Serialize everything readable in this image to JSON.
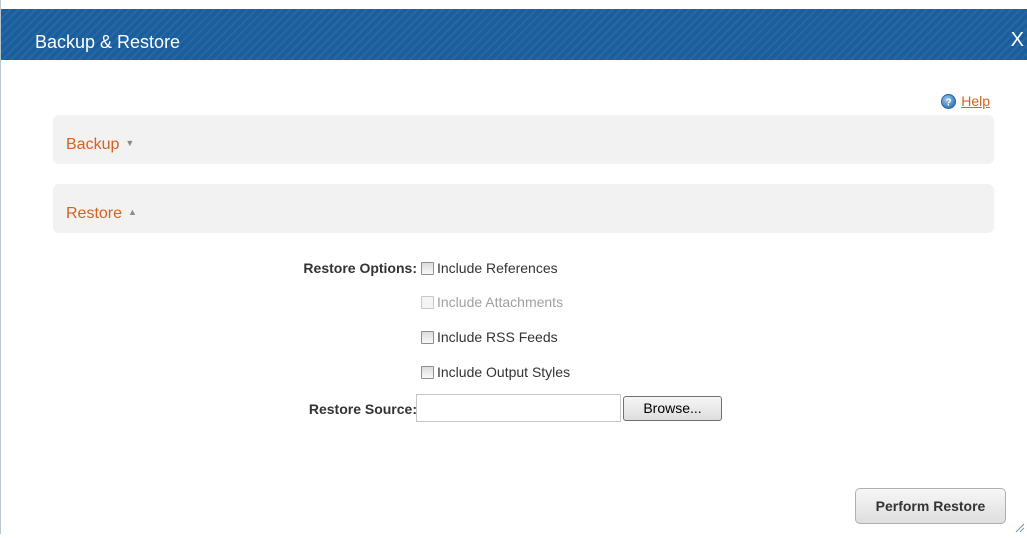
{
  "dialog": {
    "title": "Backup & Restore",
    "close_label": "X"
  },
  "help": {
    "icon": "help-question-icon",
    "label": "Help"
  },
  "sections": {
    "backup": {
      "label": "Backup",
      "arrow": "▼",
      "expanded": false
    },
    "restore": {
      "label": "Restore",
      "arrow": "▲",
      "expanded": true
    }
  },
  "restore_form": {
    "options_label": "Restore Options:",
    "options": [
      {
        "label": "Include References",
        "checked": false,
        "enabled": true
      },
      {
        "label": "Include Attachments",
        "checked": false,
        "enabled": false
      },
      {
        "label": "Include RSS Feeds",
        "checked": false,
        "enabled": true
      },
      {
        "label": "Include Output Styles",
        "checked": false,
        "enabled": true
      }
    ],
    "source_label": "Restore Source:",
    "source_value": "",
    "browse_label": "Browse..."
  },
  "footer": {
    "perform_label": "Perform Restore"
  },
  "colors": {
    "titlebar": "#1a5e9d",
    "accent_link": "#d5621f",
    "section_bg": "#f2f2f2"
  }
}
